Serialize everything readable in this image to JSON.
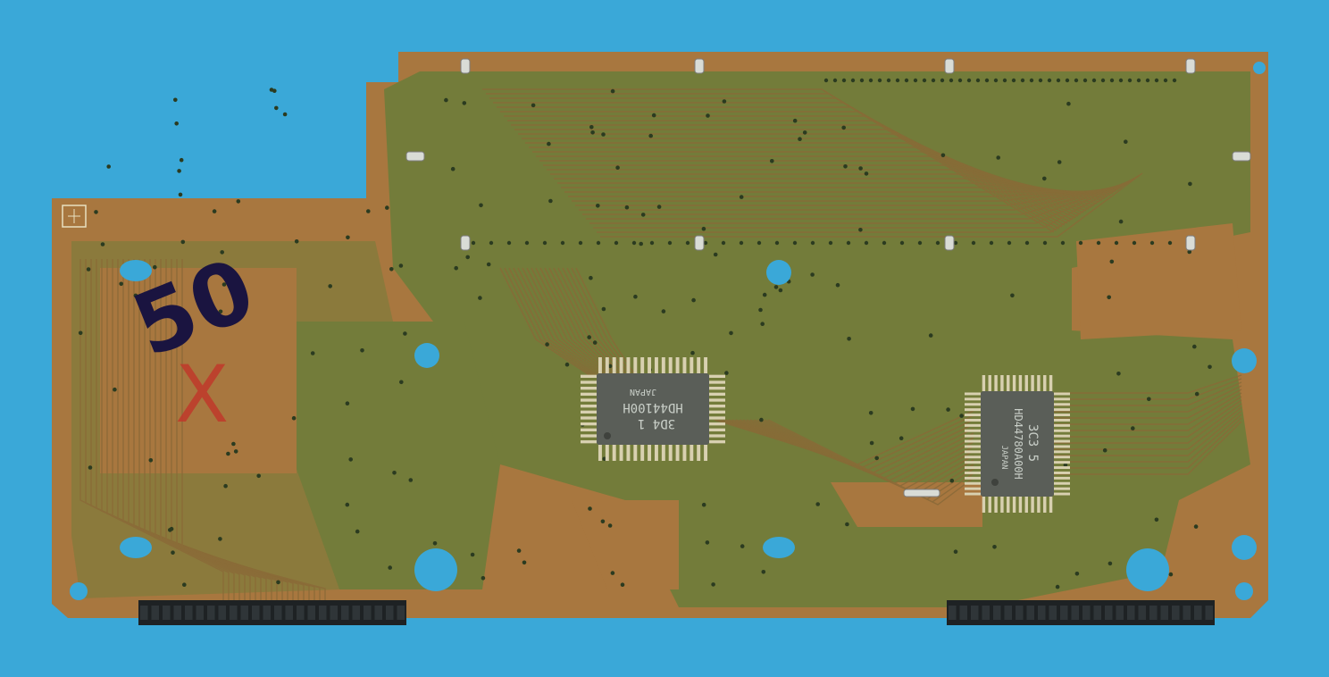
{
  "colors": {
    "background": "#3aa8d8",
    "board_copper": "#a8773f",
    "board_mask": "#6f7d3a",
    "trace": "#8a6a38",
    "chip_body": "#5a5e58",
    "chip_pins": "#d8d0b0",
    "connector": "#1e2224",
    "marker_black": "#1a1440",
    "marker_red": "#c0392b"
  },
  "handwriting": {
    "number": "50",
    "cross": "X"
  },
  "chips": [
    {
      "lines": [
        "JAPAN",
        "HD44100H",
        "3D4 1"
      ]
    },
    {
      "lines": [
        "3C3 5",
        "HD44780A00H",
        "JAPAN"
      ]
    }
  ],
  "connectors": [
    {
      "pins": 24
    },
    {
      "pins": 24
    }
  ]
}
